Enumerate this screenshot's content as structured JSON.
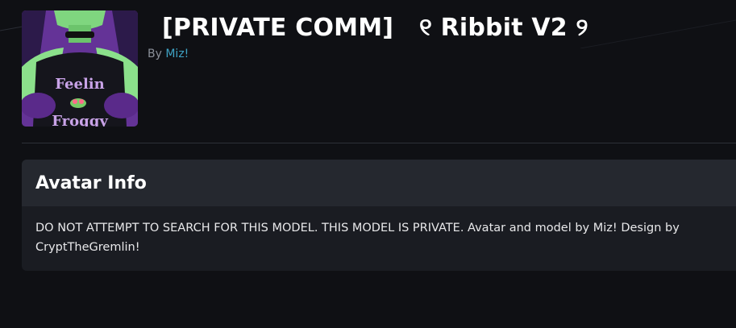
{
  "avatar": {
    "title": "[PRIVATE COMM]   ୧ Ribbit V2 ୨",
    "by_label": "By",
    "author": "Miz!",
    "thumbnail_alt": "Avatar thumbnail",
    "thumbnail_text_line1": "Feelin",
    "thumbnail_text_line2": "Froggy"
  },
  "info": {
    "heading": "Avatar Info",
    "description": "DO NOT ATTEMPT TO SEARCH FOR THIS MODEL. THIS MODEL IS PRIVATE. Avatar and model by Miz! Design by CryptTheGremlin!"
  },
  "colors": {
    "background": "#0f1014",
    "card": "#1a1c22",
    "card_header": "#25282f",
    "link": "#3fa4c6"
  }
}
